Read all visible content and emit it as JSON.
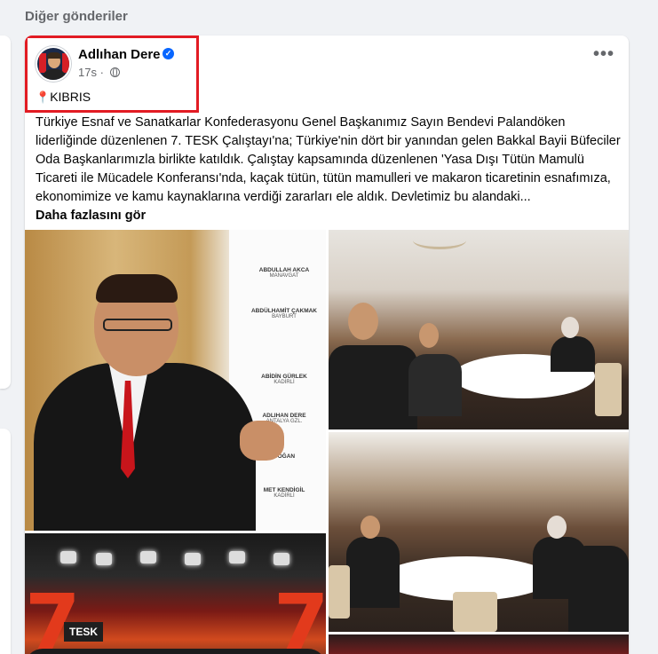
{
  "section": {
    "title": "Diğer gönderiler"
  },
  "post": {
    "author": "Adlıhan Dere",
    "verified_icon": "verified-badge-icon",
    "time": "17s",
    "separator": "·",
    "audience_icon": "globe-icon",
    "location_pin": "📍",
    "location": "KIBRIS",
    "more_icon": "•••",
    "text": "Türkiye Esnaf ve Sanatkarlar Konfederasyonu Genel Başkanımız Sayın Bendevi Palandöken liderliğinde düzenlenen 7. TESK Çalıştayı'na; Türkiye'nin dört bir yanından gelen Bakkal Bayii Büfeciler Oda Başkanlarımızla birlikte katıldık. Çalıştay kapsamında düzenlenen 'Yasa Dışı Tütün Mamulü Ticareti ile Mücadele Konferansı'nda, kaçak tütün, tütün mamulleri ve makaron ticaretinin esnafımıza, ekonomimize ve kamu kaynaklarına verdiği zararları ele aldık. Devletimiz bu alandaki...",
    "see_more": "Daha fazlasını gör",
    "signature_board": [
      {
        "name": "ABDULLAH AKCA",
        "place": "MANAVGAT"
      },
      {
        "name": "ABDÜLHAMİT ÇAKMAK",
        "place": "BAYBURT"
      },
      {
        "name": "ABİDİN GÜRLEK",
        "place": "KADİRLİ"
      },
      {
        "name": "ADLIHAN DERE",
        "place": "ANTALYA GZL."
      },
      {
        "name": "DOĞAN",
        "place": ""
      },
      {
        "name": "MET KENDİGİL",
        "place": "KADİRLİ"
      }
    ],
    "banner_text": "TESK",
    "colors": {
      "accent": "#0866ff",
      "highlight_border": "#e21b23",
      "tie": "#c8151b"
    }
  }
}
